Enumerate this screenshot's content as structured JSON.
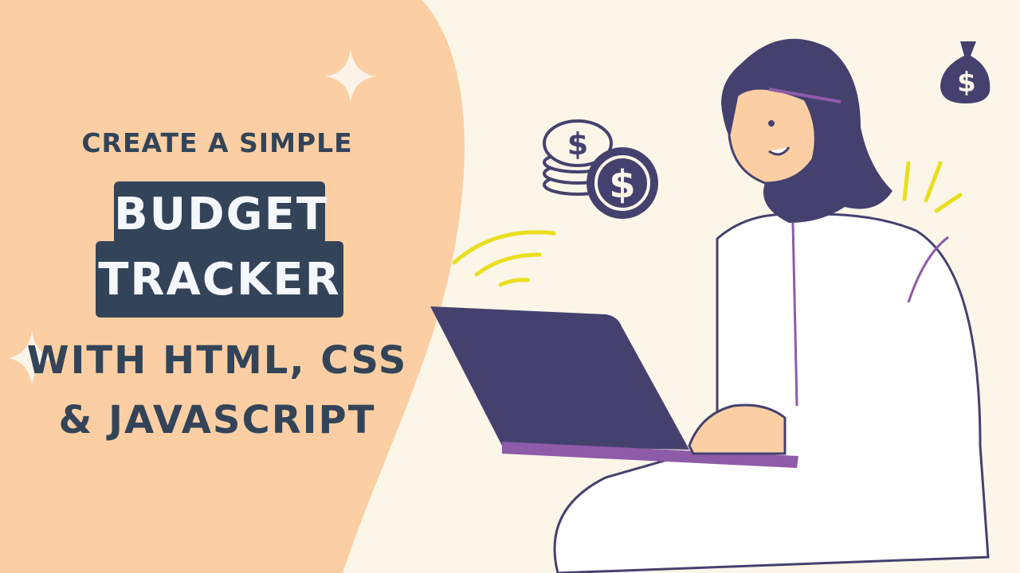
{
  "title": {
    "line1": "CREATE A SIMPLE",
    "highlight1": "BUDGET",
    "highlight2": "TRACKER",
    "line3": "WITH HTML, CSS",
    "line4": "& JAVASCRIPT"
  },
  "colors": {
    "background": "#FBF6E8",
    "peach": "#FBCFA3",
    "text": "#334459",
    "highlight_text": "#F4F7FC",
    "illustration_purple": "#45416F",
    "accent_violet": "#8E5BA8",
    "accent_yellow": "#EADF1E"
  },
  "icons": [
    "sparkle-icon",
    "coin-stack-icon",
    "dollar-coin-icon",
    "money-bag-icon"
  ]
}
